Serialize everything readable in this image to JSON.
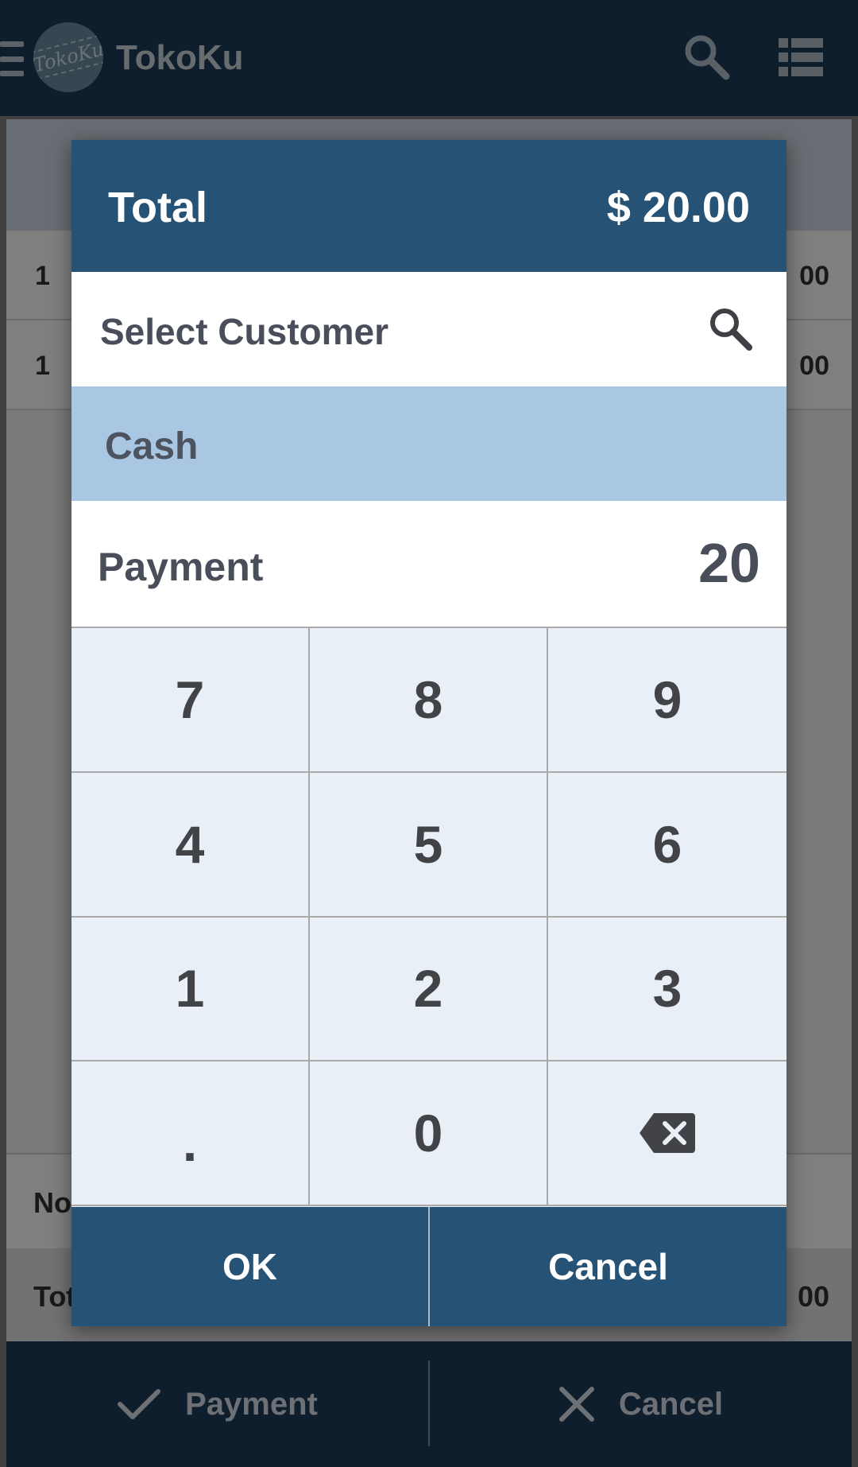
{
  "app": {
    "title": "TokoKu",
    "logo_text": "TokoKu",
    "icons": {
      "menu": "hamburger-icon",
      "search": "search-icon",
      "list": "list-icon"
    }
  },
  "background": {
    "line_items": [
      {
        "qty": "1",
        "amount": "00"
      },
      {
        "qty": "1",
        "amount": "00"
      }
    ],
    "note_label": "No",
    "total_label": "Tot",
    "total_amount": "00"
  },
  "bottom_bar": {
    "payment_label": "Payment",
    "cancel_label": "Cancel"
  },
  "dialog": {
    "total_label": "Total",
    "total_value": "$ 20.00",
    "customer_placeholder": "Select Customer",
    "payment_method": "Cash",
    "payment_label": "Payment",
    "payment_value": "20",
    "keys": [
      "7",
      "8",
      "9",
      "4",
      "5",
      "6",
      "1",
      "2",
      "3",
      ".",
      "0"
    ],
    "ok_label": "OK",
    "cancel_label": "Cancel"
  },
  "colors": {
    "primary": "#265275",
    "appbar": "#1e3d59",
    "selected_method": "#a9c7e2",
    "keypad_bg": "#e8eff6"
  }
}
